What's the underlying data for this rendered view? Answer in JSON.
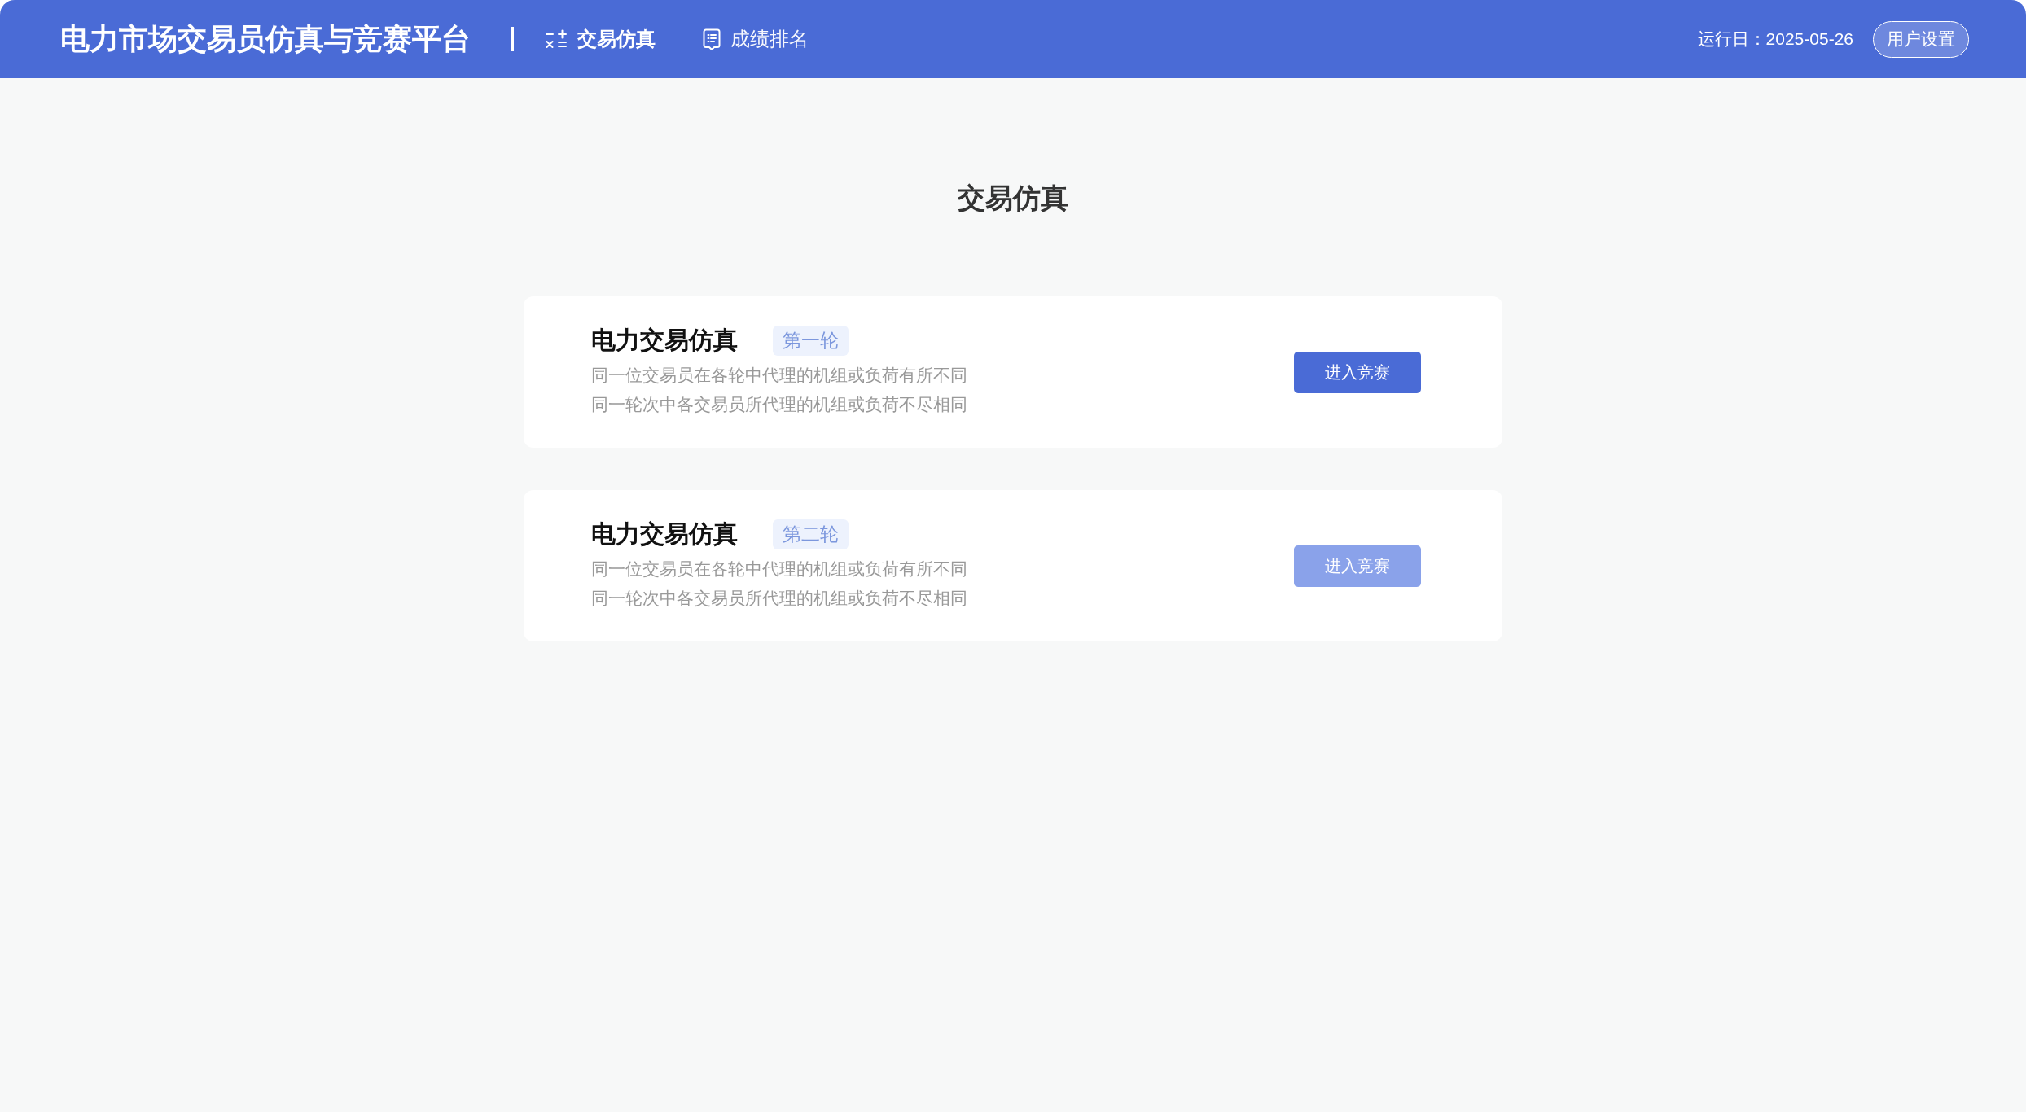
{
  "header": {
    "title": "电力市场交易员仿真与竞赛平台",
    "nav": [
      {
        "label": "交易仿真",
        "selected": true,
        "kind": "calculator"
      },
      {
        "label": "成绩排名",
        "selected": false,
        "kind": "report"
      }
    ],
    "run_date": "运行日：2025-05-26",
    "user_settings_button": "用户设置"
  },
  "page_title": "交易仿真",
  "competitions": [
    {
      "title": "电力交易仿真",
      "round": "第一轮",
      "description": [
        "同一位交易员在各轮中代理的机组或负荷有所不同",
        "同一轮次中各交易员所代理的机组或负荷不尽相同"
      ],
      "button": {
        "label": "进入竞赛",
        "disabled": false
      }
    },
    {
      "title": "电力交易仿真",
      "round": "第二轮",
      "description": [
        "同一位交易员在各轮中代理的机组或负荷有所不同",
        "同一轮次中各交易员所代理的机组或负荷不尽相同"
      ],
      "button": {
        "label": "进入竞赛",
        "disabled": true
      }
    }
  ]
}
